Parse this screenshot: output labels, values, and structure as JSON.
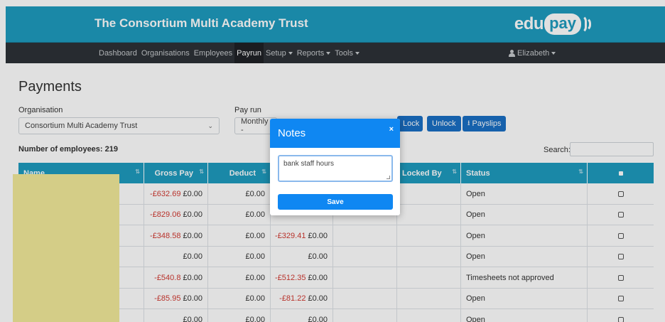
{
  "brand": {
    "title": "The Consortium Multi Academy Trust",
    "logo_prefix": "edu",
    "logo_pill": "pay"
  },
  "nav": {
    "items": [
      {
        "label": "Dashboard",
        "dropdown": false
      },
      {
        "label": "Organisations",
        "dropdown": false
      },
      {
        "label": "Employees",
        "dropdown": false
      },
      {
        "label": "Payrun",
        "dropdown": false,
        "active": true
      },
      {
        "label": "Setup",
        "dropdown": true
      },
      {
        "label": "Reports",
        "dropdown": true
      },
      {
        "label": "Tools",
        "dropdown": true
      }
    ],
    "user": "Elizabeth"
  },
  "page": {
    "title": "Payments",
    "organisation_label": "Organisation",
    "organisation_value": "Consortium Multi Academy Trust",
    "payrun_label": "Pay run",
    "payrun_value": "Monthly -",
    "employee_count_label": "Number of employees: 219",
    "buttons": {
      "lock": "Lock",
      "unlock": "Unlock",
      "payslips": "Payslips"
    },
    "search_label": "Search:"
  },
  "table": {
    "columns": [
      "Name",
      "Gross Pay",
      "Deduct",
      "",
      "",
      "Locked By",
      "Status"
    ],
    "rows": [
      {
        "gross_neg": "-£632.69",
        "gross": "£0.00",
        "deduct": "£0.00",
        "net_neg": "",
        "net": "",
        "status": "Open"
      },
      {
        "gross_neg": "-£829.06",
        "gross": "£0.00",
        "deduct": "£0.00",
        "net_neg": "",
        "net": "",
        "status": "Open"
      },
      {
        "gross_neg": "-£348.58",
        "gross": "£0.00",
        "deduct": "£0.00",
        "net_neg": "-£329.41",
        "net": "£0.00",
        "status": "Open"
      },
      {
        "gross_neg": "",
        "gross": "£0.00",
        "deduct": "£0.00",
        "net_neg": "",
        "net": "£0.00",
        "status": "Open"
      },
      {
        "gross_neg": "-£540.8",
        "gross": "£0.00",
        "deduct": "£0.00",
        "net_neg": "-£512.35",
        "net": "£0.00",
        "status": "Timesheets not approved"
      },
      {
        "gross_neg": "-£85.95",
        "gross": "£0.00",
        "deduct": "£0.00",
        "net_neg": "-£81.22",
        "net": "£0.00",
        "status": "Open"
      },
      {
        "gross_neg": "",
        "gross": "£0.00",
        "deduct": "£0.00",
        "net_neg": "",
        "net": "£0.00",
        "status": "Open"
      }
    ]
  },
  "modal": {
    "title": "Notes",
    "close": "×",
    "notes_value": "bank staff hours",
    "save_label": "Save"
  },
  "colors": {
    "brand": "#1e9bbf",
    "navbar": "#2d3237",
    "primary_button": "#1a6fc4",
    "modal_accent": "#0f87f2",
    "negative": "#d23a32"
  }
}
